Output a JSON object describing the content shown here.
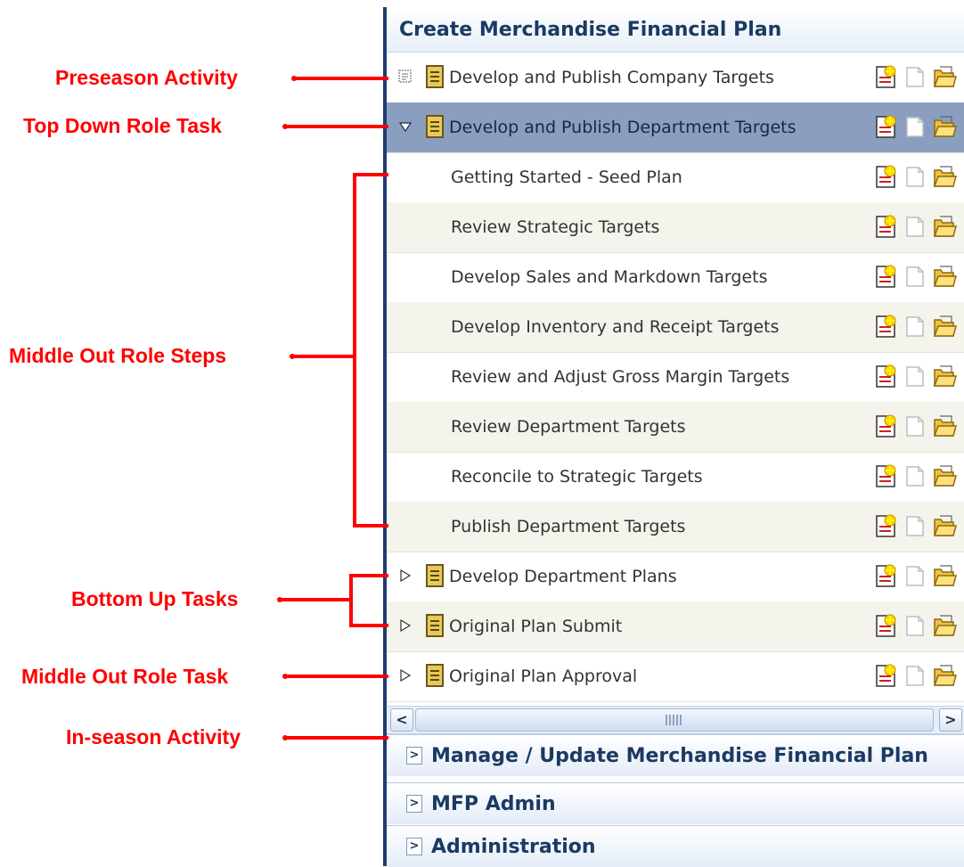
{
  "annotations": {
    "preseason_activity": "Preseason Activity",
    "top_down_role_task": "Top Down Role Task",
    "middle_out_role_steps": "Middle Out Role Steps",
    "bottom_up_tasks": "Bottom Up Tasks",
    "middle_out_role_task": "Middle Out Role Task",
    "in_season_activity": "In-season Activity"
  },
  "colors": {
    "annotation": "#ff0000",
    "selected_row": "#8a9fc0",
    "panel_border": "#1e3d6e",
    "header_text": "#1b3a63"
  },
  "panel": {
    "title": "Create Merchandise Financial Plan",
    "rows": [
      {
        "label": "Develop and Publish Company Targets",
        "type": "activity",
        "toggle": "dotted-box-icon"
      },
      {
        "label": "Develop and Publish Department Targets",
        "type": "task",
        "toggle": "triangle-down-icon",
        "selected": true
      },
      {
        "label": "Getting Started - Seed Plan",
        "type": "step"
      },
      {
        "label": "Review Strategic Targets",
        "type": "step"
      },
      {
        "label": "Develop Sales and Markdown Targets",
        "type": "step"
      },
      {
        "label": "Develop Inventory and Receipt Targets",
        "type": "step"
      },
      {
        "label": "Review and Adjust Gross Margin Targets",
        "type": "step"
      },
      {
        "label": "Review Department Targets",
        "type": "step"
      },
      {
        "label": "Reconcile to Strategic Targets",
        "type": "step"
      },
      {
        "label": "Publish Department Targets",
        "type": "step"
      },
      {
        "label": "Develop Department Plans",
        "type": "task",
        "toggle": "triangle-right-icon"
      },
      {
        "label": "Original Plan Submit",
        "type": "task",
        "toggle": "triangle-right-icon"
      },
      {
        "label": "Original Plan Approval",
        "type": "task",
        "toggle": "triangle-right-icon"
      }
    ],
    "row_actions": [
      "new-page-icon",
      "blank-page-icon",
      "open-folder-icon"
    ],
    "scrollbar": {
      "left": "<",
      "right": ">"
    }
  },
  "collapsed_sections": [
    {
      "toggle": ">",
      "title": "Manage / Update Merchandise Financial Plan"
    },
    {
      "toggle": ">",
      "title": "MFP Admin"
    },
    {
      "toggle": ">",
      "title": "Administration"
    }
  ]
}
